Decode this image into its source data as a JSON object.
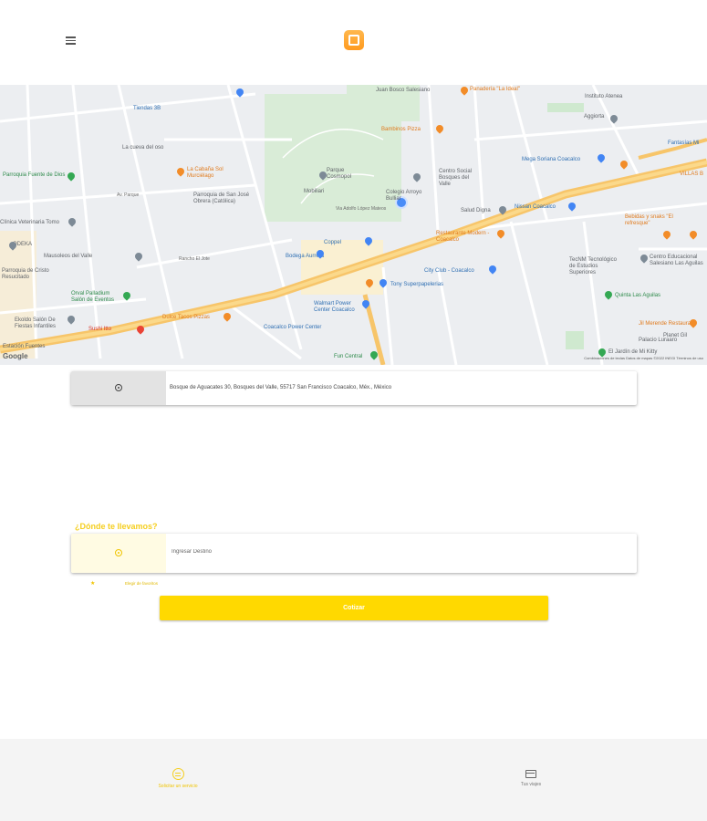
{
  "header": {
    "menu_icon": "hamburger-menu-icon",
    "logo_icon": "app-logo-icon"
  },
  "map": {
    "attribution_logo": "Google",
    "footer": "Combinaciones de teclas   Datos de mapas ©2022 INEGI   Términos de uso",
    "pois": {
      "tiendas_3b": "Tiendas 3B",
      "la_cueva": "La cueva del oso",
      "fuente_dios": "Parroquia Fuente de Dios",
      "cabana_sol": "La Cabaña Sol Murciélago",
      "parroquia_san_jose": "Parroquia de San José Obrera (Católica)",
      "parque_cosmopol": "Parque Cosmopol",
      "mobiliari": "Mobiliari",
      "colegio_arroyo": "Colegio Arroyo Bulliar",
      "juan_bosco": "Juan Bosco Salesiano",
      "panaderia": "Panadería \"La Ideal\"",
      "bambinos": "Bambinos Pizza",
      "centro_social": "Centro Social Bosques del Valle",
      "salud_digna": "Salud Digna",
      "nissan": "Nissan Coacalco",
      "restaurante_modern": "Restaurante Modern - Coacalco",
      "instituto_atenea": "Instituto Atenea",
      "aggiorta": "Aggiorta",
      "mega_soriana": "Mega Soriana Coacalco",
      "fantasias": "Fantasías Mi",
      "villas": "VILLAS B",
      "bebidas": "Bebidas y snaks \"El refresque\"",
      "tecnm": "TecNM Tecnológico de Estudios Superiores",
      "centro_educacional": "Centro Educacional Salesiano Las Aguilas",
      "quinta": "Quinta Las Aguilas",
      "jilmerende": "Jil Merende Restaurant",
      "planet": "Planet Gil",
      "palacio": "Palacio Luraaro",
      "jardin": "El Jardín de Mi Kitty",
      "coppel": "Coppel",
      "aurrera": "Bodega Aurrera",
      "city_club": "City Club - Coacalco",
      "tony": "Tony Superpapelerias",
      "walmart": "Walmart Power Center Coacalco",
      "coacalco_power": "Coacalco Power Center",
      "fun_central": "Fun Central",
      "sushi": "Sushi Itto",
      "burger": "Dulce Tacos Pizzas",
      "mausoleos": "Mausoleos del Valle",
      "parroquia_resucitado": "Parroquia de Cristo Resucitado",
      "orval": "Orval Palladium Salón de Eventos",
      "ekoldo": "Ekoldo Salón De Fiestas Infantiles",
      "estacion": "Estación Fuentes",
      "veterinaria": "Clínica Veterinaria Tomo",
      "odeka": "ODEKA",
      "fuentes_gal": "Fuentes"
    },
    "streets": {
      "vialidad": "Via Adolfo López Mateos",
      "av_parque": "Av. Parque",
      "rancho_el_jote": "Rancho El Jote"
    }
  },
  "origin": {
    "icon": "current-location-icon",
    "address": "Bosque de Aguacates 30, Bosques del Valle, 55717 San Francisco Coacalco, Méx., México"
  },
  "destination": {
    "title": "¿Dónde te llevamos?",
    "icon": "destination-pin-icon",
    "placeholder": "Ingresar Destino",
    "value": ""
  },
  "favorites": {
    "icon": "star-icon",
    "label": "Elegir de favoritos"
  },
  "actions": {
    "quote_label": "Cotizar"
  },
  "bottom_nav": {
    "items": [
      {
        "label": "Solicitar un servicio",
        "icon": "request-service-icon",
        "active": true
      },
      {
        "label": "Tus viajes",
        "icon": "trips-icon",
        "active": false
      }
    ]
  },
  "colors": {
    "accent": "#ffd900",
    "accent_text": "#f5cf20",
    "map_highway": "#f7c56a"
  }
}
